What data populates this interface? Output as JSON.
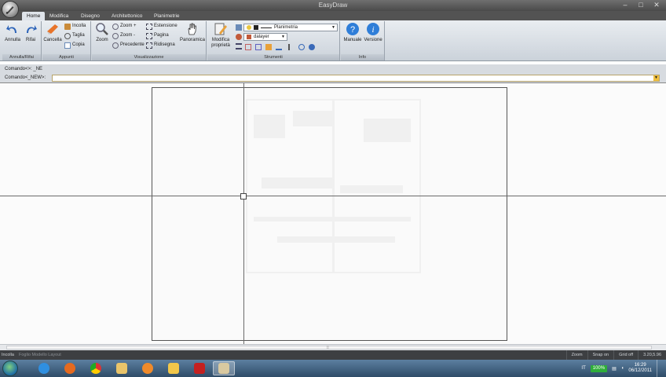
{
  "window": {
    "title": "EasyDraw",
    "minimize": "–",
    "maximize": "□",
    "close": "✕"
  },
  "tabs": [
    "Home",
    "Modifica",
    "Disegno",
    "Architettonico",
    "Planimetrie"
  ],
  "ribbon": {
    "groups": {
      "undo": {
        "label": "Annulla/Rifai",
        "undo": "Annulla",
        "redo": "Rifai"
      },
      "clipboard": {
        "label": "Appunti",
        "delete": "Cancella",
        "paste": "Incolla",
        "cut": "Taglia",
        "copy": "Copia"
      },
      "view": {
        "label": "Visualizzazione",
        "zoom": "Zoom",
        "zoom_in": "Zoom +",
        "zoom_out": "Zoom -",
        "previous": "Precedente",
        "extension": "Estensione",
        "page": "Pagina",
        "redraw": "Ridisegna",
        "pan": "Panoramica"
      },
      "tools": {
        "label": "Strumenti",
        "modify_props": "Modifica proprietà",
        "linetype_value": "Planimetria",
        "layer_value": "dalayer"
      },
      "info": {
        "label": "Info",
        "manual": "Manuale",
        "version": "Versione"
      }
    }
  },
  "command": {
    "line1": "Comando<>: _NE",
    "line2_label": "Comando<_NEW>:",
    "input_value": ""
  },
  "statusbar": {
    "left": "Incolla",
    "tabs": "Foglio Modello Layout",
    "zoom": "Zoom",
    "snap": "Snap on",
    "grid": "Grid off",
    "coords": "3.20,5.96"
  },
  "taskbar": {
    "lang": "IT",
    "battery": "100%",
    "time": "16:29",
    "date": "06/12/2011"
  },
  "colors": {
    "accent": "#1d5fa8",
    "ribbon": "#dfe4ea",
    "titlebar": "#4a4a4a"
  },
  "icons": [
    "app-orb-icon",
    "undo-icon",
    "redo-icon",
    "delete-icon",
    "paste-icon",
    "cut-icon",
    "copy-icon",
    "zoom-icon",
    "zoom-in-icon",
    "zoom-out-icon",
    "previous-icon",
    "extension-icon",
    "page-icon",
    "redraw-icon",
    "pan-hand-icon",
    "properties-icon",
    "help-icon",
    "info-icon",
    "windows-start-icon",
    "ie-icon",
    "firefox-icon",
    "chrome-icon",
    "folder-icon",
    "media-icon",
    "explorer-icon",
    "pdf-icon",
    "easydraw-icon"
  ]
}
